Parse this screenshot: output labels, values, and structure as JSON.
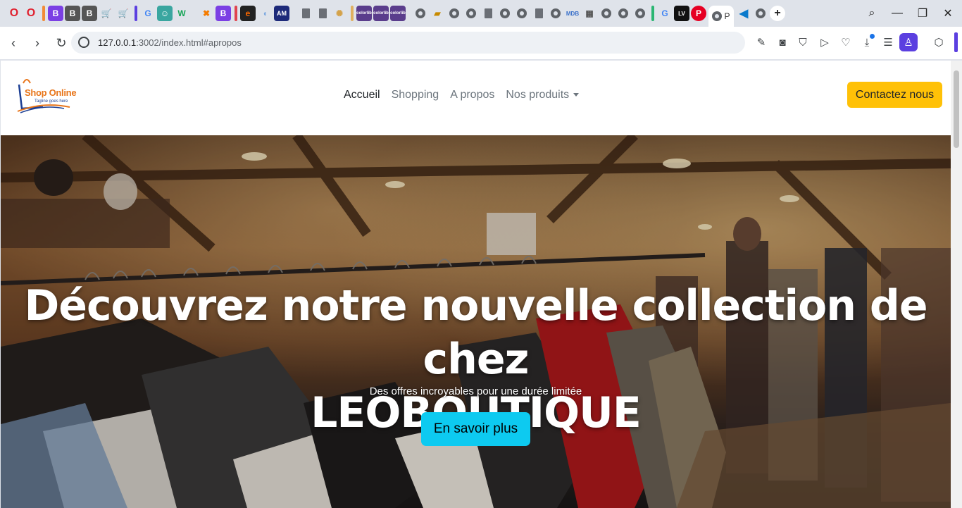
{
  "browser": {
    "address": {
      "host": "127.0.0.1",
      "rest": ":3002/index.html#apropos"
    },
    "active_tab_label": "P",
    "tab_icons": [
      "opera-logo",
      "opera-logo",
      "bootstrap-logo",
      "bootstrap-logo",
      "bootstrap-logo",
      "cart-icon",
      "cart-icon",
      "google-logo",
      "avatar-icon",
      "w-logo",
      "colorful-logo",
      "bootstrap-logo",
      "e-logo",
      "shield-icon",
      "am-logo",
      "document-icon",
      "document-icon",
      "settings-icon",
      "colorlib-icon",
      "colorlib-icon",
      "colorlib-icon",
      "globe-icon",
      "stack-icon",
      "globe-icon",
      "globe-icon",
      "document-icon",
      "globe-icon",
      "globe-icon",
      "document-icon",
      "globe-icon",
      "mdb-logo",
      "grid-icon",
      "globe-icon",
      "globe-icon",
      "globe-icon",
      "google-logo",
      "lvst-logo",
      "pinterest-logo",
      "globe-icon",
      "vscode-logo",
      "globe-icon"
    ],
    "colors": {
      "accent": "#5b3fe0"
    }
  },
  "site": {
    "logo": {
      "name": "Shop Online",
      "tagline": "Tagline goes here"
    },
    "nav": {
      "home": "Accueil",
      "shopping": "Shopping",
      "about": "A propos",
      "products": "Nos produits"
    },
    "contact_button": "Contactez nous",
    "colors": {
      "warning": "#ffc107",
      "info": "#0dcaf0",
      "logo_orange": "#e8751a",
      "logo_blue": "#1c3f94"
    }
  },
  "hero": {
    "title_line1": "Découvrez notre nouvelle collection de chez",
    "title_line2": "LEOBOUTIQUE",
    "subtitle": "Des offres incroyables pour une durée limitée",
    "cta": "En savoir plus"
  }
}
